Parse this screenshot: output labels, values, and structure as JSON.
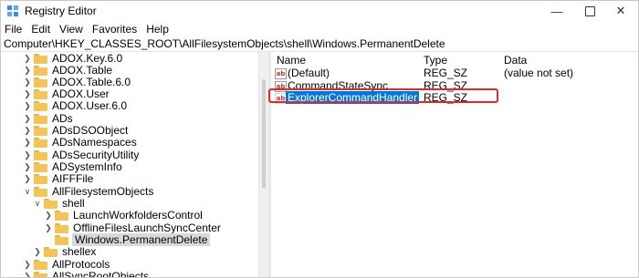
{
  "window": {
    "title": "Registry Editor"
  },
  "menu": [
    "File",
    "Edit",
    "View",
    "Favorites",
    "Help"
  ],
  "address": "Computer\\HKEY_CLASSES_ROOT\\AllFilesystemObjects\\shell\\Windows.PermanentDelete",
  "tree": {
    "items": [
      {
        "label": "ADOX.Key.6.0"
      },
      {
        "label": "ADOX.Table"
      },
      {
        "label": "ADOX.Table.6.0"
      },
      {
        "label": "ADOX.User"
      },
      {
        "label": "ADOX.User.6.0"
      },
      {
        "label": "ADs"
      },
      {
        "label": "ADsDSOObject"
      },
      {
        "label": "ADsNamespaces"
      },
      {
        "label": "ADsSecurityUtility"
      },
      {
        "label": "ADSystemInfo"
      },
      {
        "label": "AIFFFile"
      },
      {
        "label": "AllFilesystemObjects"
      },
      {
        "label": "shell"
      },
      {
        "label": "LaunchWorkfoldersControl"
      },
      {
        "label": "OfflineFilesLaunchSyncCenter"
      },
      {
        "label": "Windows.PermanentDelete"
      },
      {
        "label": "shellex"
      },
      {
        "label": "AllProtocols"
      },
      {
        "label": "AllSyncRootObjects"
      }
    ]
  },
  "list": {
    "headers": {
      "name": "Name",
      "type": "Type",
      "data": "Data"
    },
    "rows": [
      {
        "name": "(Default)",
        "type": "REG_SZ",
        "data": "(value not set)"
      },
      {
        "name": "CommandStateSync",
        "type": "REG_SZ",
        "data": ""
      },
      {
        "name": "ExplorerCommandHandler",
        "type": "REG_SZ",
        "data": ""
      }
    ]
  },
  "icons": {
    "value_icon_text": "ab"
  },
  "colors": {
    "selection": "#0078d7",
    "highlight_border": "#e02a2a",
    "folder": "#f3c45a"
  }
}
